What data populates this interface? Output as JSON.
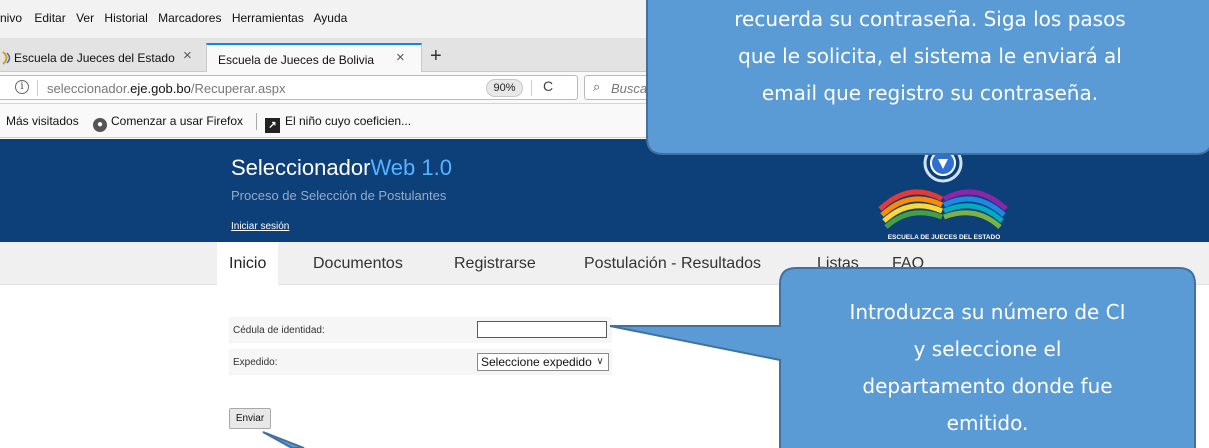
{
  "browser": {
    "menu": [
      "nivo",
      "Editar",
      "Ver",
      "Historial",
      "Marcadores",
      "Herramientas",
      "Ayuda"
    ],
    "tabs": [
      {
        "label": "Escuela de Jueces del Estado",
        "close": "×"
      },
      {
        "label": "Escuela de Jueces de Bolivia",
        "close": "×"
      }
    ],
    "new_tab": "+",
    "url_prefix": "seleccionador.",
    "url_domain": "eje.gob.bo",
    "url_path": "/Recuperar.aspx",
    "zoom": "90%",
    "reload": "C",
    "search_placeholder": "Buscar",
    "bookmarks": [
      "Más visitados",
      "Comenzar a usar Firefox",
      "El niño cuyo coeficien..."
    ]
  },
  "site": {
    "brand_main": "Seleccionador",
    "brand_highlight": "Web 1.0",
    "subtitle": "Proceso de Selección de Postulantes",
    "login": "Iniciar sesión",
    "logo_text": "ESCUELA DE JUECES DEL ESTADO"
  },
  "nav": [
    "Inicio",
    "Documentos",
    "Registrarse",
    "Postulación - Resultados",
    "Listas",
    "FAQ"
  ],
  "form": {
    "ci_label": "Cédula de identidad:",
    "ci_value": "",
    "exp_label": "Expedido:",
    "exp_selected": "Seleccione expedido",
    "submit": "Enviar"
  },
  "callouts": {
    "top_lines": [
      "recuerda su contraseña. Siga los pasos",
      "que le solicita, el sistema le enviará al",
      "email que registro su contraseña."
    ],
    "right_lines": [
      "Introduzca su número de CI",
      "y seleccione el",
      "departamento donde fue",
      "emitido."
    ]
  },
  "colors": {
    "header_bg": "#0d3f78",
    "brand_highlight": "#55b4ff",
    "callout_fill": "#5b9bd5",
    "callout_stroke": "#41719c"
  }
}
